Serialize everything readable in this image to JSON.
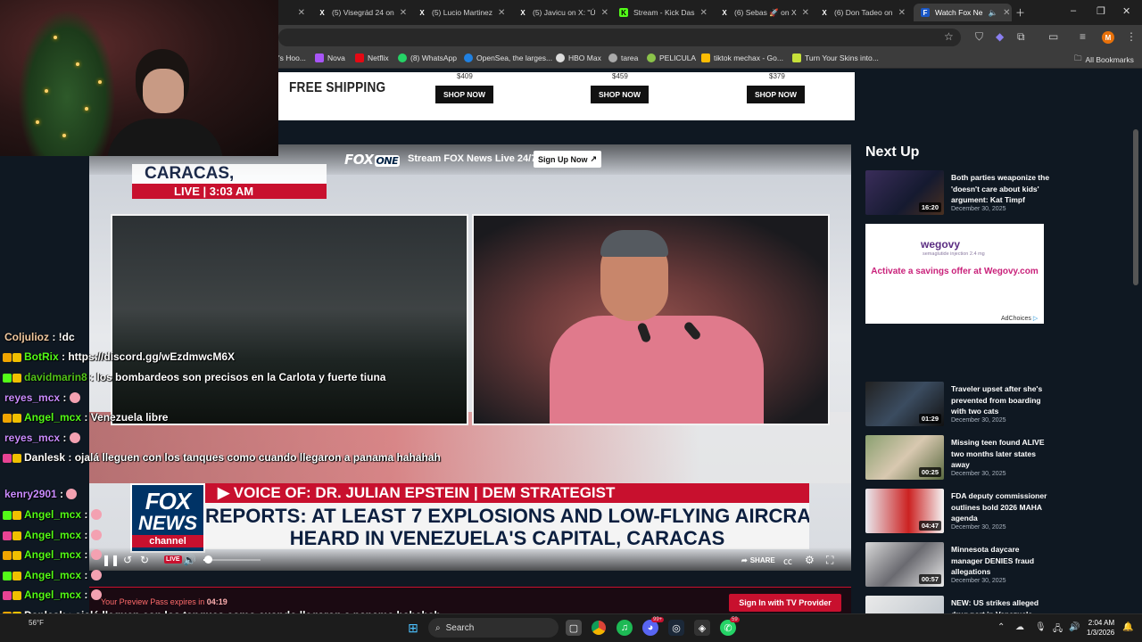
{
  "browser": {
    "tabs": [
      {
        "label": "Visegrád 24 on",
        "favicon": "x-icon"
      },
      {
        "label": "(5) Visegrád 24 on",
        "favicon": "x-icon"
      },
      {
        "label": "(5) Lucio Martinez",
        "favicon": "x-icon"
      },
      {
        "label": "(5) Javicu on X: \"Ú",
        "favicon": "x-icon"
      },
      {
        "label": "Stream - Kick Das",
        "favicon": "kick-icon"
      },
      {
        "label": "(6) Sebas 🚀 on X",
        "favicon": "x-icon"
      },
      {
        "label": "(6) Don Tadeo on",
        "favicon": "x-icon"
      },
      {
        "label": "Watch Fox Ne",
        "favicon": "fox-icon",
        "active": true
      }
    ],
    "bookmarks": [
      "'s Hoo...",
      "Nova",
      "Netflix",
      "(8) WhatsApp",
      "OpenSea, the larges...",
      "HBO Max",
      "tarea",
      "PELICULA",
      "tiktok mechax - Go...",
      "Turn Your Skins into..."
    ],
    "all_bookmarks": "All Bookmarks",
    "profile_initial": "M"
  },
  "ad_banner": {
    "headline": "FREE SHIPPING",
    "prices": [
      "$409",
      "$459",
      "$379"
    ],
    "button_label": "SHOP NOW"
  },
  "player": {
    "brand": "FOX",
    "brand_suffix": "ONE",
    "stream_text": "Stream FOX News Live 24/7",
    "signup_label": "Sign Up Now",
    "location": "CARACAS, VENEZUELA",
    "live_line": "LIVE | 3:03 AM",
    "strap_top": "▶ VOICE OF: DR. JULIAN EPSTEIN  |  DEM STRATEGIST",
    "strap_line1": "REPORTS: AT LEAST 7 EXPLOSIONS AND LOW-FLYING AIRCRAFT",
    "strap_line2": "HEARD IN VENEZUELA'S CAPITAL, CARACAS",
    "logo_line1": "FOX",
    "logo_line2": "NEWS",
    "logo_line3": "channel",
    "live_badge": "LIVE",
    "share_label": "SHARE",
    "volume_level": 0.05
  },
  "preview": {
    "text": "Your Preview Pass expires in",
    "time": "04:19",
    "button_label": "Sign In with TV Provider"
  },
  "sidebar": {
    "heading": "Next Up",
    "videos": [
      {
        "title": "Both parties weaponize the 'doesn't care about kids' argument: Kat Timpf",
        "date": "December 30, 2025",
        "duration": "16:20"
      },
      {
        "title": "Traveler upset after she's prevented from boarding with two cats",
        "date": "December 30, 2025",
        "duration": "01:29"
      },
      {
        "title": "Missing teen found ALIVE two months later states away",
        "date": "December 30, 2025",
        "duration": "00:25"
      },
      {
        "title": "FDA deputy commissioner outlines bold 2026 MAHA agenda",
        "date": "December 30, 2025",
        "duration": "04:47"
      },
      {
        "title": "Minnesota daycare manager DENIES fraud allegations",
        "date": "December 30, 2025",
        "duration": "00:57"
      },
      {
        "title": "NEW: US strikes alleged drug port in Venezuela",
        "date": "",
        "duration": ""
      }
    ],
    "ad": {
      "brand": "wegovy",
      "brand_sub": "semaglutide injection 2.4 mg",
      "cta": "Activate a savings offer at Wegovy.com",
      "adchoices": "AdChoices"
    }
  },
  "chat": [
    {
      "user": "Coljulioz",
      "message": "!dc",
      "color": "#f0c8a0"
    },
    {
      "user": "BotRix",
      "message": "https://discord.gg/wEzdmwcM6X",
      "color": "#53fc18"
    },
    {
      "user": "davidmarin8",
      "message": "los bombardeos son precisos en la Carlota y fuerte tiuna",
      "color": "#52c41a"
    },
    {
      "user": "reyes_mcx",
      "message": "",
      "color": "#c98cff"
    },
    {
      "user": "Angel_mcx",
      "message": "Venezuela libre",
      "color": "#53fc18"
    },
    {
      "user": "reyes_mcx",
      "message": "",
      "color": "#c98cff"
    },
    {
      "user": "Danlesk",
      "message": "ojalá lleguen con los tanques como cuando llegaron a panama hahahah",
      "color": "#ffffff"
    },
    {
      "user": "kenry2901",
      "message": "",
      "color": "#c98cff"
    },
    {
      "user": "Angel_mcx",
      "message": "",
      "color": "#53fc18"
    },
    {
      "user": "Angel_mcx",
      "message": "",
      "color": "#53fc18"
    },
    {
      "user": "Angel_mcx",
      "message": "",
      "color": "#53fc18"
    },
    {
      "user": "Angel_mcx",
      "message": "",
      "color": "#53fc18"
    },
    {
      "user": "Angel_mcx",
      "message": "",
      "color": "#53fc18"
    },
    {
      "user": "Danlesk",
      "message": "ojalá lleguen con los tanques como cuando llegaron a panama hahahah",
      "color": "#ffffff"
    }
  ],
  "taskbar": {
    "search_placeholder": "Search",
    "time": "2:04 AM",
    "date": "1/3/2026",
    "temperature": "56°F",
    "badge_counts": [
      "99+",
      "59"
    ]
  }
}
